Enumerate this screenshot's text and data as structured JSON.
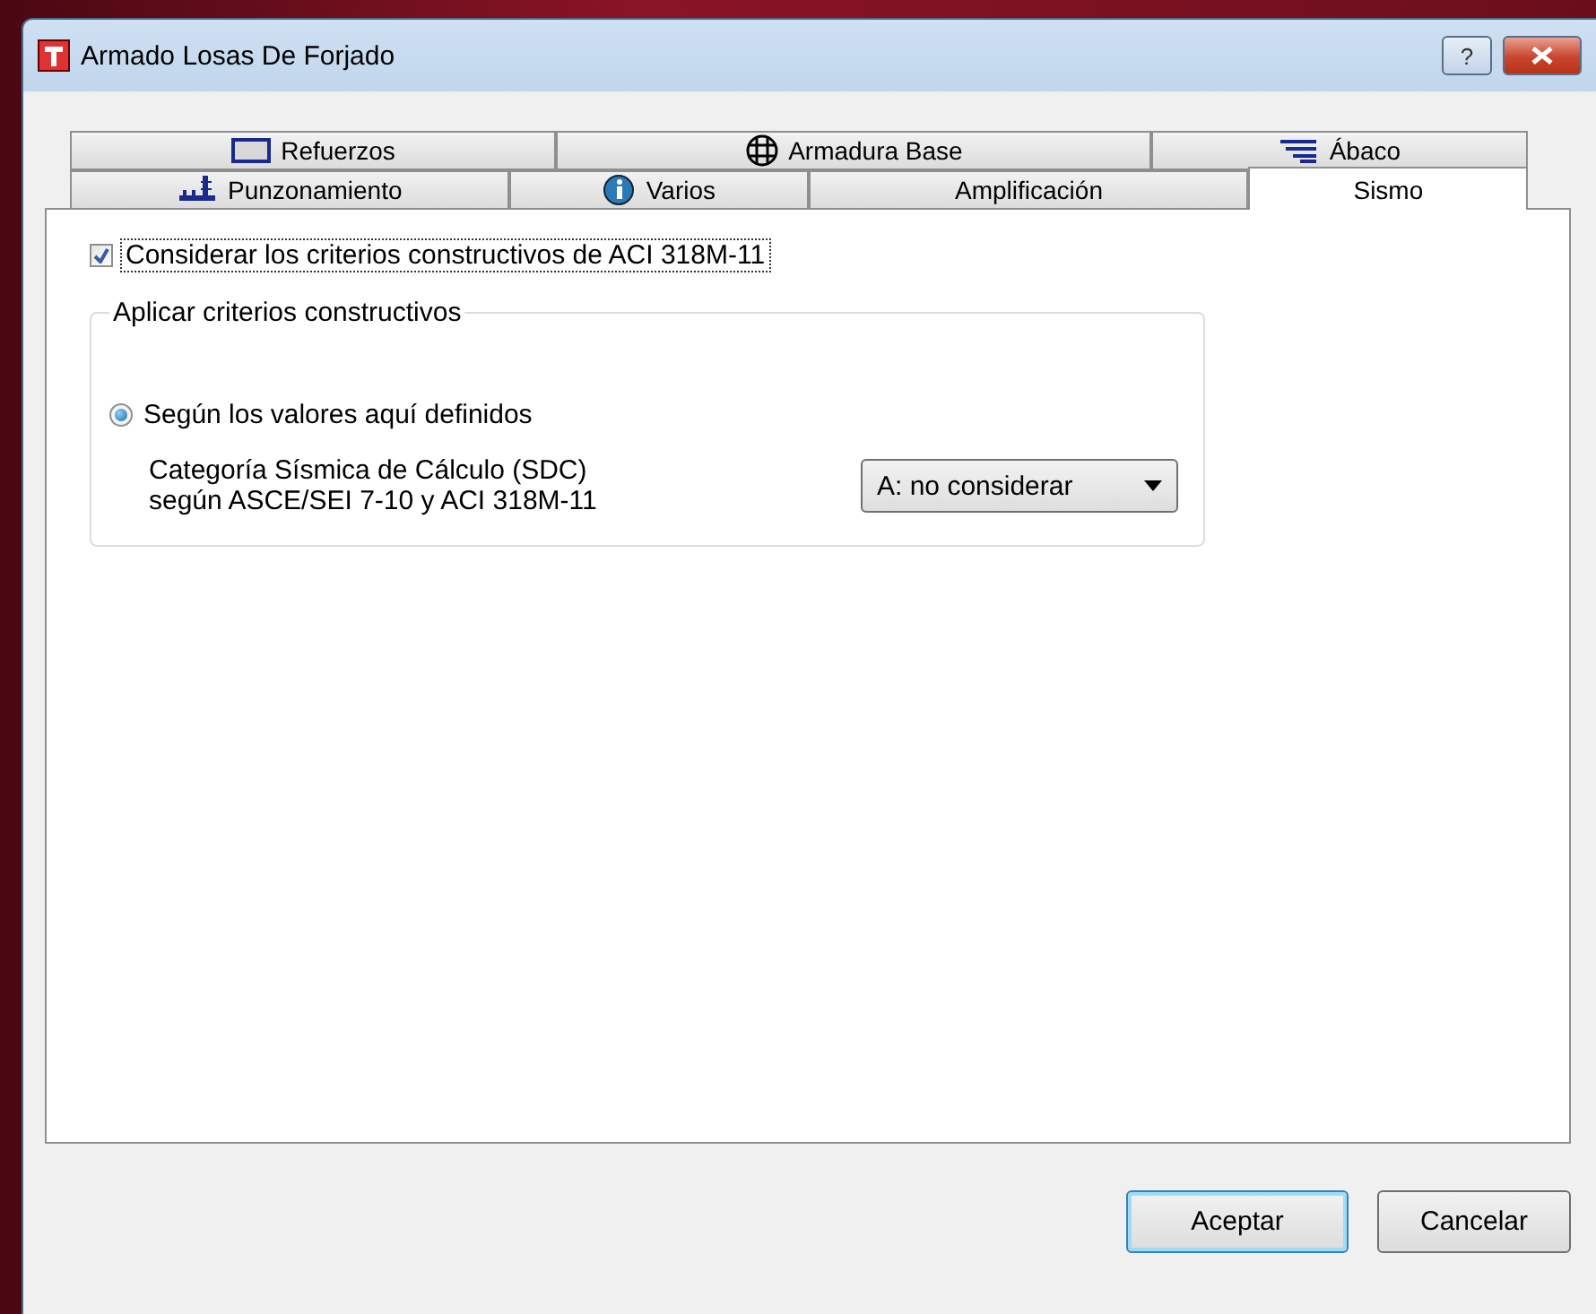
{
  "window": {
    "title": "Armado Losas De Forjado",
    "help_button": "?"
  },
  "tab_rows": [
    {
      "tabs": [
        {
          "label": "Refuerzos",
          "selected": false
        },
        {
          "label": "Armadura Base",
          "selected": false
        },
        {
          "label": "Ábaco",
          "selected": false
        }
      ]
    },
    {
      "tabs": [
        {
          "label": "Punzonamiento",
          "selected": false
        },
        {
          "label": "Varios",
          "selected": false
        },
        {
          "label": "Amplificación",
          "selected": false
        },
        {
          "label": "Sismo",
          "selected": true
        }
      ]
    }
  ],
  "consider_checkbox": {
    "label": "Considerar los criterios constructivos de  ACI 318M-11",
    "checked": true
  },
  "group": {
    "title": "Aplicar criterios constructivos",
    "radio": {
      "label": "Según los valores aquí definidos",
      "selected": true
    },
    "sdc_label": [
      "Categoría Sísmica de Cálculo (SDC)",
      "según ASCE/SEI 7-10 y ACI 318M-11"
    ],
    "sdc_value": "A: no considerar"
  },
  "buttons": [
    {
      "label": "Aceptar",
      "default": true
    },
    {
      "label": "Cancelar",
      "default": false
    }
  ]
}
